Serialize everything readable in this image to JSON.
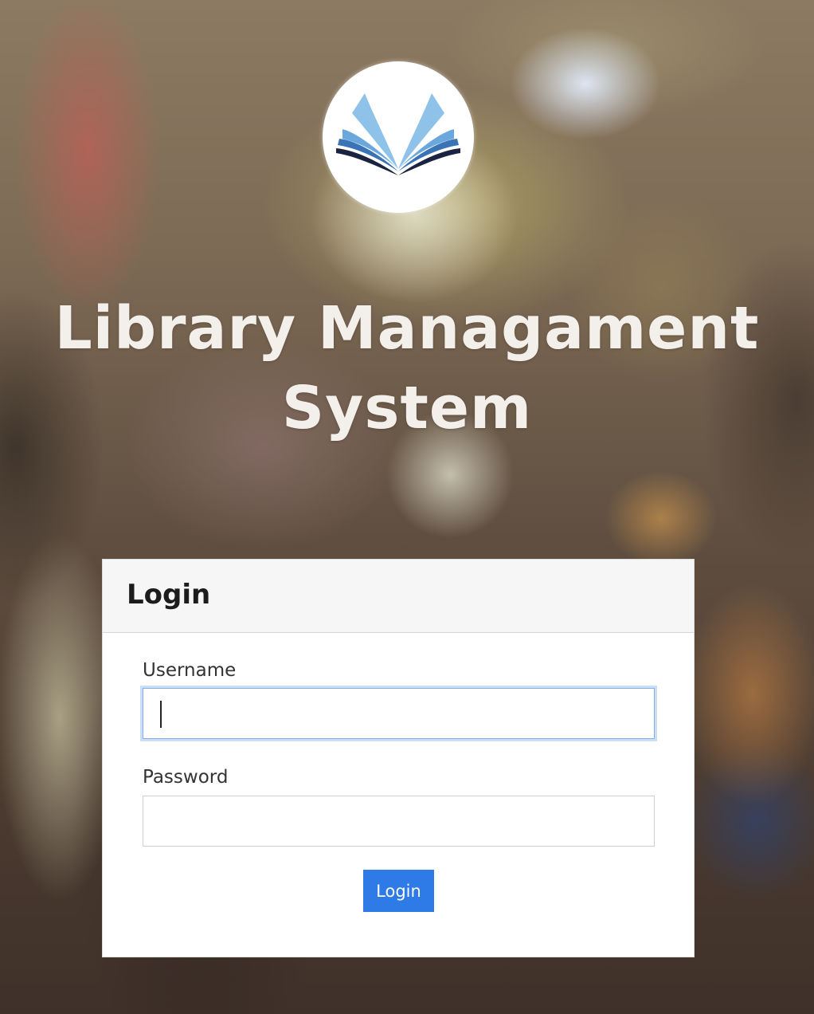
{
  "app": {
    "title_line1": "Library Managament",
    "title_line2": "System",
    "logo_icon": "open-book-icon"
  },
  "login_card": {
    "heading": "Login",
    "username": {
      "label": "Username",
      "value": "",
      "placeholder": ""
    },
    "password": {
      "label": "Password",
      "value": "",
      "placeholder": ""
    },
    "submit_label": "Login"
  },
  "colors": {
    "button": "#2e7ae6",
    "focus_ring": "#86b0e8",
    "book_light": "#8ec2e8",
    "book_mid": "#3a74b6",
    "book_dark": "#1a2440"
  }
}
